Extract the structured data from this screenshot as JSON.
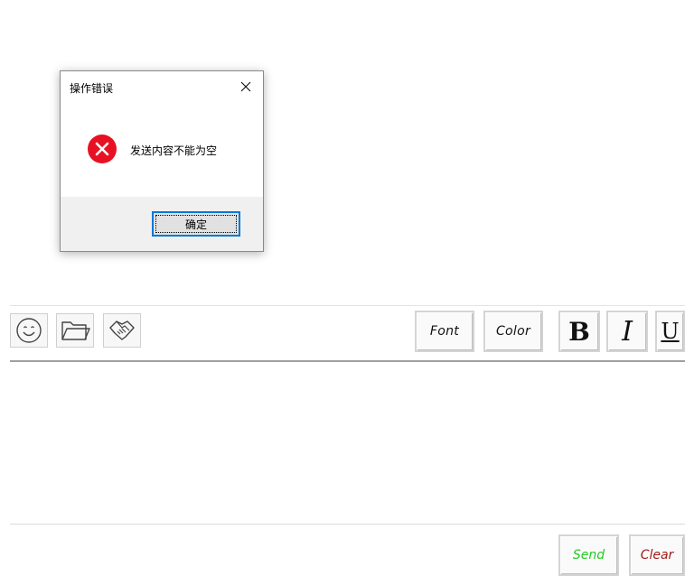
{
  "dialog": {
    "title": "操作错误",
    "message": "发送内容不能为空",
    "ok_label": "确定",
    "error_color": "#e81123"
  },
  "toolbar": {
    "icons": [
      "smiley-icon",
      "folder-icon",
      "handshake-icon"
    ],
    "font_label": "Font",
    "color_label": "Color",
    "bold_label": "B",
    "italic_label": "I",
    "underline_label": "U"
  },
  "input": {
    "value": ""
  },
  "actions": {
    "send_label": "Send",
    "send_color": "#22cc22",
    "clear_label": "Clear",
    "clear_color": "#a11a1a"
  }
}
